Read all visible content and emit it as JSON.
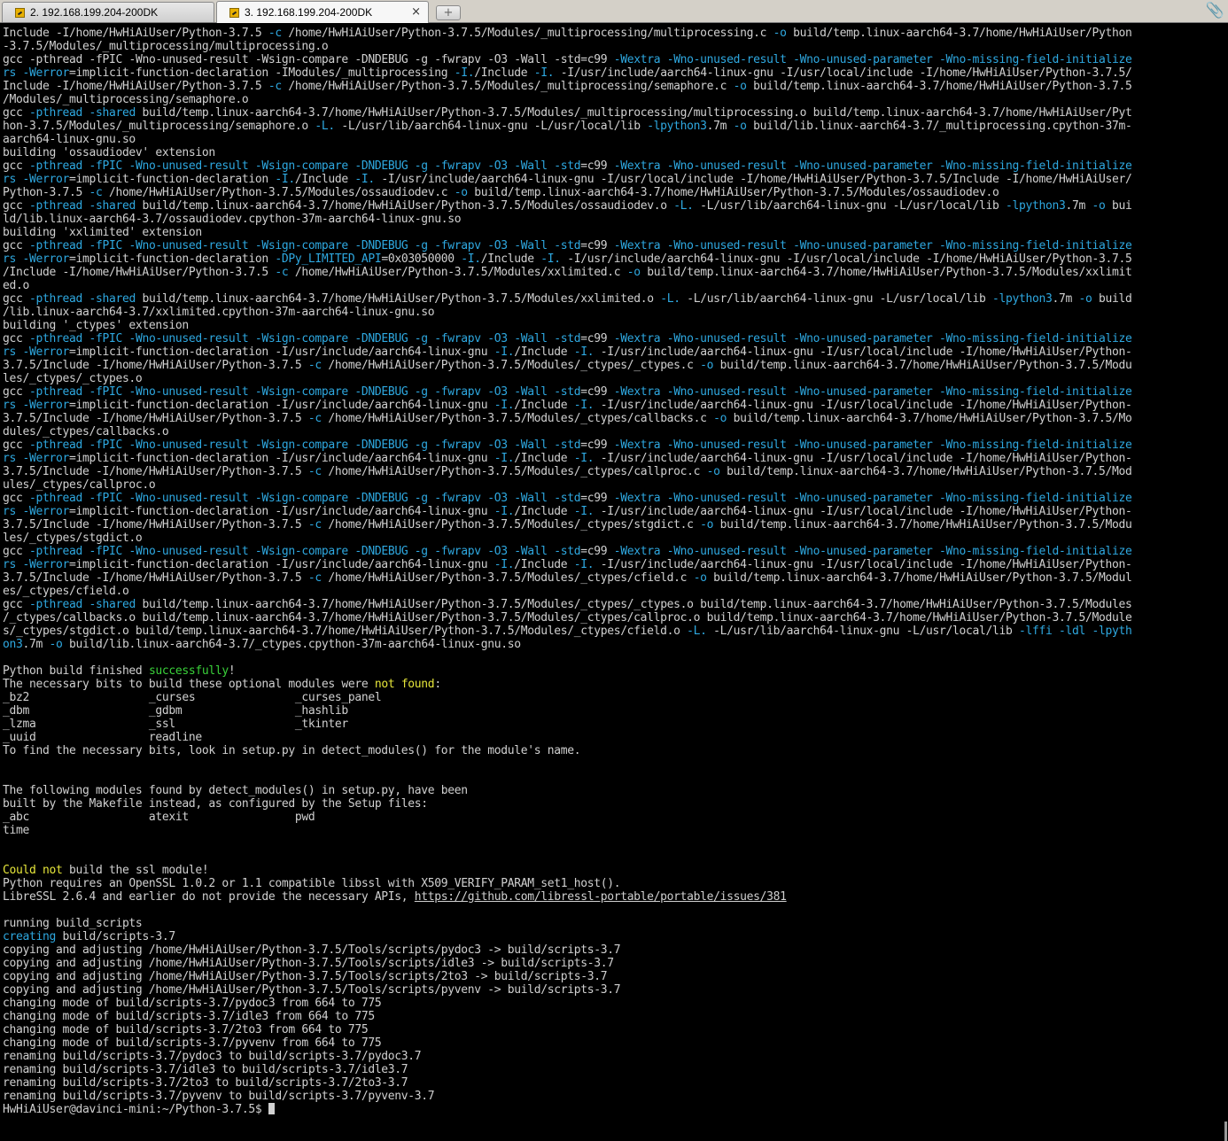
{
  "tabs": [
    {
      "label": "2. 192.168.199.204-200DK",
      "active": false
    },
    {
      "label": "3. 192.168.199.204-200DK",
      "active": true
    }
  ],
  "new_tab_symbol": "+",
  "close_symbol": "×",
  "attach_symbol": "📎",
  "colors": {
    "background": "#000000",
    "text": "#d0d0d0",
    "option": "#2ea8e0",
    "success": "#3ad23a",
    "warning": "#e6e63a"
  },
  "terminal": {
    "lines": [
      [
        [
          "Include -I/home/HwHiAiUser/Python-3.7.5 ",
          ""
        ],
        [
          "-c",
          "c"
        ],
        [
          " /home/HwHiAiUser/Python-3.7.5/Modules/_multiprocessing/multiprocessing.c ",
          ""
        ],
        [
          "-o",
          "c"
        ],
        [
          " build/temp.linux-aarch64-3.7/home/HwHiAiUser/Python",
          ""
        ]
      ],
      [
        [
          "-3.7.5/Modules/_multiprocessing/multiprocessing.o",
          ""
        ]
      ],
      [
        [
          "gcc ",
          ""
        ],
        [
          "-pthread -fPIC -Wno-unused-result -Wsign-compare -DNDEBUG -g -fwrapv -O3 -Wall -std",
          ""
        ],
        [
          "=c99 ",
          ""
        ],
        [
          "-Wextra -Wno-unused-result -Wno-unused-parameter -Wno-missing-field-initialize",
          "c"
        ]
      ],
      [
        [
          "rs -Werror",
          "c"
        ],
        [
          "=implicit-function-declaration -IModules/_multiprocessing ",
          ""
        ],
        [
          "-I.",
          "c"
        ],
        [
          "/Include ",
          ""
        ],
        [
          "-I.",
          "c"
        ],
        [
          " -I/usr/include/aarch64-linux-gnu -I/usr/local/include -I/home/HwHiAiUser/Python-3.7.5/",
          ""
        ]
      ],
      [
        [
          "Include -I/home/HwHiAiUser/Python-3.7.5 ",
          ""
        ],
        [
          "-c",
          "c"
        ],
        [
          " /home/HwHiAiUser/Python-3.7.5/Modules/_multiprocessing/semaphore.c ",
          ""
        ],
        [
          "-o",
          "c"
        ],
        [
          " build/temp.linux-aarch64-3.7/home/HwHiAiUser/Python-3.7.5",
          ""
        ]
      ],
      [
        [
          "/Modules/_multiprocessing/semaphore.o",
          ""
        ]
      ],
      [
        [
          "gcc ",
          ""
        ],
        [
          "-pthread -shared",
          "c"
        ],
        [
          " build/temp.linux-aarch64-3.7/home/HwHiAiUser/Python-3.7.5/Modules/_multiprocessing/multiprocessing.o build/temp.linux-aarch64-3.7/home/HwHiAiUser/Pyt",
          ""
        ]
      ],
      [
        [
          "hon-3.7.5/Modules/_multiprocessing/semaphore.o ",
          ""
        ],
        [
          "-L.",
          "c"
        ],
        [
          " -L/usr/lib/aarch64-linux-gnu -L/usr/local/lib ",
          ""
        ],
        [
          "-lpython3",
          "c"
        ],
        [
          ".7m ",
          ""
        ],
        [
          "-o",
          "c"
        ],
        [
          " build/lib.linux-aarch64-3.7/_multiprocessing.cpython-37m-",
          ""
        ]
      ],
      [
        [
          "aarch64-linux-gnu.so",
          ""
        ]
      ],
      [
        [
          "building 'ossaudiodev' extension",
          ""
        ]
      ],
      [
        [
          "gcc ",
          ""
        ],
        [
          "-pthread -fPIC -Wno-unused-result -Wsign-compare -DNDEBUG -g -fwrapv -O3 -Wall -std",
          "c"
        ],
        [
          "=c99 ",
          ""
        ],
        [
          "-Wextra -Wno-unused-result -Wno-unused-parameter -Wno-missing-field-initialize",
          "c"
        ]
      ],
      [
        [
          "rs -Werror",
          "c"
        ],
        [
          "=implicit-function-declaration ",
          ""
        ],
        [
          "-I.",
          "c"
        ],
        [
          "/Include ",
          ""
        ],
        [
          "-I.",
          "c"
        ],
        [
          " -I/usr/include/aarch64-linux-gnu -I/usr/local/include -I/home/HwHiAiUser/Python-3.7.5/Include -I/home/HwHiAiUser/",
          ""
        ]
      ],
      [
        [
          "Python-3.7.5 ",
          ""
        ],
        [
          "-c",
          "c"
        ],
        [
          " /home/HwHiAiUser/Python-3.7.5/Modules/ossaudiodev.c ",
          ""
        ],
        [
          "-o",
          "c"
        ],
        [
          " build/temp.linux-aarch64-3.7/home/HwHiAiUser/Python-3.7.5/Modules/ossaudiodev.o",
          ""
        ]
      ],
      [
        [
          "gcc ",
          ""
        ],
        [
          "-pthread -shared",
          "c"
        ],
        [
          " build/temp.linux-aarch64-3.7/home/HwHiAiUser/Python-3.7.5/Modules/ossaudiodev.o ",
          ""
        ],
        [
          "-L.",
          "c"
        ],
        [
          " -L/usr/lib/aarch64-linux-gnu -L/usr/local/lib ",
          ""
        ],
        [
          "-lpython3",
          "c"
        ],
        [
          ".7m ",
          ""
        ],
        [
          "-o",
          "c"
        ],
        [
          " bui",
          ""
        ]
      ],
      [
        [
          "ld/lib.linux-aarch64-3.7/ossaudiodev.cpython-37m-aarch64-linux-gnu.so",
          ""
        ]
      ],
      [
        [
          "building 'xxlimited' extension",
          ""
        ]
      ],
      [
        [
          "gcc ",
          ""
        ],
        [
          "-pthread -fPIC -Wno-unused-result -Wsign-compare -DNDEBUG -g -fwrapv -O3 -Wall -std",
          "c"
        ],
        [
          "=c99 ",
          ""
        ],
        [
          "-Wextra -Wno-unused-result -Wno-unused-parameter -Wno-missing-field-initialize",
          "c"
        ]
      ],
      [
        [
          "rs -Werror",
          "c"
        ],
        [
          "=implicit-function-declaration ",
          ""
        ],
        [
          "-DPy_LIMITED_API",
          "c"
        ],
        [
          "=0x03050000 ",
          ""
        ],
        [
          "-I.",
          "c"
        ],
        [
          "/Include ",
          ""
        ],
        [
          "-I.",
          "c"
        ],
        [
          " -I/usr/include/aarch64-linux-gnu -I/usr/local/include -I/home/HwHiAiUser/Python-3.7.5",
          ""
        ]
      ],
      [
        [
          "/Include -I/home/HwHiAiUser/Python-3.7.5 ",
          ""
        ],
        [
          "-c",
          "c"
        ],
        [
          " /home/HwHiAiUser/Python-3.7.5/Modules/xxlimited.c ",
          ""
        ],
        [
          "-o",
          "c"
        ],
        [
          " build/temp.linux-aarch64-3.7/home/HwHiAiUser/Python-3.7.5/Modules/xxlimit",
          ""
        ]
      ],
      [
        [
          "ed.o",
          ""
        ]
      ],
      [
        [
          "gcc ",
          ""
        ],
        [
          "-pthread -shared",
          "c"
        ],
        [
          " build/temp.linux-aarch64-3.7/home/HwHiAiUser/Python-3.7.5/Modules/xxlimited.o ",
          ""
        ],
        [
          "-L.",
          "c"
        ],
        [
          " -L/usr/lib/aarch64-linux-gnu -L/usr/local/lib ",
          ""
        ],
        [
          "-lpython3",
          "c"
        ],
        [
          ".7m ",
          ""
        ],
        [
          "-o",
          "c"
        ],
        [
          " build",
          ""
        ]
      ],
      [
        [
          "/lib.linux-aarch64-3.7/xxlimited.cpython-37m-aarch64-linux-gnu.so",
          ""
        ]
      ],
      [
        [
          "building '_ctypes' extension",
          ""
        ]
      ],
      [
        [
          "gcc ",
          ""
        ],
        [
          "-pthread -fPIC -Wno-unused-result -Wsign-compare -DNDEBUG -g -fwrapv -O3 -Wall -std",
          "c"
        ],
        [
          "=c99 ",
          ""
        ],
        [
          "-Wextra -Wno-unused-result -Wno-unused-parameter -Wno-missing-field-initialize",
          "c"
        ]
      ],
      [
        [
          "rs -Werror",
          "c"
        ],
        [
          "=implicit-function-declaration -I/usr/include/aarch64-linux-gnu ",
          ""
        ],
        [
          "-I.",
          "c"
        ],
        [
          "/Include ",
          ""
        ],
        [
          "-I.",
          "c"
        ],
        [
          " -I/usr/include/aarch64-linux-gnu -I/usr/local/include -I/home/HwHiAiUser/Python-",
          ""
        ]
      ],
      [
        [
          "3.7.5/Include -I/home/HwHiAiUser/Python-3.7.5 ",
          ""
        ],
        [
          "-c",
          "c"
        ],
        [
          " /home/HwHiAiUser/Python-3.7.5/Modules/_ctypes/_ctypes.c ",
          ""
        ],
        [
          "-o",
          "c"
        ],
        [
          " build/temp.linux-aarch64-3.7/home/HwHiAiUser/Python-3.7.5/Modu",
          ""
        ]
      ],
      [
        [
          "les/_ctypes/_ctypes.o",
          ""
        ]
      ],
      [
        [
          "gcc ",
          ""
        ],
        [
          "-pthread -fPIC -Wno-unused-result -Wsign-compare -DNDEBUG -g -fwrapv -O3 -Wall -std",
          "c"
        ],
        [
          "=c99 ",
          ""
        ],
        [
          "-Wextra -Wno-unused-result -Wno-unused-parameter -Wno-missing-field-initialize",
          "c"
        ]
      ],
      [
        [
          "rs -Werror",
          "c"
        ],
        [
          "=implicit-function-declaration -I/usr/include/aarch64-linux-gnu ",
          ""
        ],
        [
          "-I.",
          "c"
        ],
        [
          "/Include ",
          ""
        ],
        [
          "-I.",
          "c"
        ],
        [
          " -I/usr/include/aarch64-linux-gnu -I/usr/local/include -I/home/HwHiAiUser/Python-",
          ""
        ]
      ],
      [
        [
          "3.7.5/Include -I/home/HwHiAiUser/Python-3.7.5 ",
          ""
        ],
        [
          "-c",
          "c"
        ],
        [
          " /home/HwHiAiUser/Python-3.7.5/Modules/_ctypes/callbacks.c ",
          ""
        ],
        [
          "-o",
          "c"
        ],
        [
          " build/temp.linux-aarch64-3.7/home/HwHiAiUser/Python-3.7.5/Mo",
          ""
        ]
      ],
      [
        [
          "dules/_ctypes/callbacks.o",
          ""
        ]
      ],
      [
        [
          "gcc ",
          ""
        ],
        [
          "-pthread -fPIC -Wno-unused-result -Wsign-compare -DNDEBUG -g -fwrapv -O3 -Wall -std",
          "c"
        ],
        [
          "=c99 ",
          ""
        ],
        [
          "-Wextra -Wno-unused-result -Wno-unused-parameter -Wno-missing-field-initialize",
          "c"
        ]
      ],
      [
        [
          "rs -Werror",
          "c"
        ],
        [
          "=implicit-function-declaration -I/usr/include/aarch64-linux-gnu ",
          ""
        ],
        [
          "-I.",
          "c"
        ],
        [
          "/Include ",
          ""
        ],
        [
          "-I.",
          "c"
        ],
        [
          " -I/usr/include/aarch64-linux-gnu -I/usr/local/include -I/home/HwHiAiUser/Python-",
          ""
        ]
      ],
      [
        [
          "3.7.5/Include -I/home/HwHiAiUser/Python-3.7.5 ",
          ""
        ],
        [
          "-c",
          "c"
        ],
        [
          " /home/HwHiAiUser/Python-3.7.5/Modules/_ctypes/callproc.c ",
          ""
        ],
        [
          "-o",
          "c"
        ],
        [
          " build/temp.linux-aarch64-3.7/home/HwHiAiUser/Python-3.7.5/Mod",
          ""
        ]
      ],
      [
        [
          "ules/_ctypes/callproc.o",
          ""
        ]
      ],
      [
        [
          "gcc ",
          ""
        ],
        [
          "-pthread -fPIC -Wno-unused-result -Wsign-compare -DNDEBUG -g -fwrapv -O3 -Wall -std",
          "c"
        ],
        [
          "=c99 ",
          ""
        ],
        [
          "-Wextra -Wno-unused-result -Wno-unused-parameter -Wno-missing-field-initialize",
          "c"
        ]
      ],
      [
        [
          "rs -Werror",
          "c"
        ],
        [
          "=implicit-function-declaration -I/usr/include/aarch64-linux-gnu ",
          ""
        ],
        [
          "-I.",
          "c"
        ],
        [
          "/Include ",
          ""
        ],
        [
          "-I.",
          "c"
        ],
        [
          " -I/usr/include/aarch64-linux-gnu -I/usr/local/include -I/home/HwHiAiUser/Python-",
          ""
        ]
      ],
      [
        [
          "3.7.5/Include -I/home/HwHiAiUser/Python-3.7.5 ",
          ""
        ],
        [
          "-c",
          "c"
        ],
        [
          " /home/HwHiAiUser/Python-3.7.5/Modules/_ctypes/stgdict.c ",
          ""
        ],
        [
          "-o",
          "c"
        ],
        [
          " build/temp.linux-aarch64-3.7/home/HwHiAiUser/Python-3.7.5/Modu",
          ""
        ]
      ],
      [
        [
          "les/_ctypes/stgdict.o",
          ""
        ]
      ],
      [
        [
          "gcc ",
          ""
        ],
        [
          "-pthread -fPIC -Wno-unused-result -Wsign-compare -DNDEBUG -g -fwrapv -O3 -Wall -std",
          "c"
        ],
        [
          "=c99 ",
          ""
        ],
        [
          "-Wextra -Wno-unused-result -Wno-unused-parameter -Wno-missing-field-initialize",
          "c"
        ]
      ],
      [
        [
          "rs -Werror",
          "c"
        ],
        [
          "=implicit-function-declaration -I/usr/include/aarch64-linux-gnu ",
          ""
        ],
        [
          "-I.",
          "c"
        ],
        [
          "/Include ",
          ""
        ],
        [
          "-I.",
          "c"
        ],
        [
          " -I/usr/include/aarch64-linux-gnu -I/usr/local/include -I/home/HwHiAiUser/Python-",
          ""
        ]
      ],
      [
        [
          "3.7.5/Include -I/home/HwHiAiUser/Python-3.7.5 ",
          ""
        ],
        [
          "-c",
          "c"
        ],
        [
          " /home/HwHiAiUser/Python-3.7.5/Modules/_ctypes/cfield.c ",
          ""
        ],
        [
          "-o",
          "c"
        ],
        [
          " build/temp.linux-aarch64-3.7/home/HwHiAiUser/Python-3.7.5/Modul",
          ""
        ]
      ],
      [
        [
          "es/_ctypes/cfield.o",
          ""
        ]
      ],
      [
        [
          "gcc ",
          ""
        ],
        [
          "-pthread -shared",
          "c"
        ],
        [
          " build/temp.linux-aarch64-3.7/home/HwHiAiUser/Python-3.7.5/Modules/_ctypes/_ctypes.o build/temp.linux-aarch64-3.7/home/HwHiAiUser/Python-3.7.5/Modules",
          ""
        ]
      ],
      [
        [
          "/_ctypes/callbacks.o build/temp.linux-aarch64-3.7/home/HwHiAiUser/Python-3.7.5/Modules/_ctypes/callproc.o build/temp.linux-aarch64-3.7/home/HwHiAiUser/Python-3.7.5/Module",
          ""
        ]
      ],
      [
        [
          "s/_ctypes/stgdict.o build/temp.linux-aarch64-3.7/home/HwHiAiUser/Python-3.7.5/Modules/_ctypes/cfield.o ",
          ""
        ],
        [
          "-L.",
          "c"
        ],
        [
          " -L/usr/lib/aarch64-linux-gnu -L/usr/local/lib ",
          ""
        ],
        [
          "-lffi -ldl -lpyth",
          "c"
        ]
      ],
      [
        [
          "on3",
          "c"
        ],
        [
          ".7m ",
          ""
        ],
        [
          "-o",
          "c"
        ],
        [
          " build/lib.linux-aarch64-3.7/_ctypes.cpython-37m-aarch64-linux-gnu.so",
          ""
        ]
      ],
      [],
      [
        [
          "Python build finished ",
          ""
        ],
        [
          "successfully",
          "g"
        ],
        [
          "!",
          ""
        ]
      ],
      [
        [
          "The necessary bits to build these optional modules were ",
          ""
        ],
        [
          "not found",
          "y"
        ],
        [
          ":",
          ""
        ]
      ],
      [
        [
          "_bz2                  _curses               _curses_panel",
          ""
        ]
      ],
      [
        [
          "_dbm                  _gdbm                 _hashlib",
          ""
        ]
      ],
      [
        [
          "_lzma                 _ssl                  _tkinter",
          ""
        ]
      ],
      [
        [
          "_uuid                 readline",
          ""
        ]
      ],
      [
        [
          "To find the necessary bits, look in setup.py in detect_modules() for the module's name.",
          ""
        ]
      ],
      [],
      [],
      [
        [
          "The following modules found by detect_modules() in setup.py, have been",
          ""
        ]
      ],
      [
        [
          "built by the Makefile instead, as configured by the Setup files:",
          ""
        ]
      ],
      [
        [
          "_abc                  atexit                pwd",
          ""
        ]
      ],
      [
        [
          "time",
          ""
        ]
      ],
      [],
      [],
      [
        [
          "Could not",
          "y"
        ],
        [
          " build the ssl module!",
          ""
        ]
      ],
      [
        [
          "Python requires an OpenSSL 1.0.2 or 1.1 compatible libssl with X509_VERIFY_PARAM_set1_host().",
          ""
        ]
      ],
      [
        [
          "LibreSSL 2.6.4 and earlier do not provide the necessary APIs, ",
          ""
        ],
        [
          "https://github.com/libressl-portable/portable/issues/381",
          "u"
        ]
      ],
      [],
      [
        [
          "running build_scripts",
          ""
        ]
      ],
      [
        [
          "creating",
          "c"
        ],
        [
          " build/scripts-3.7",
          ""
        ]
      ],
      [
        [
          "copying and adjusting /home/HwHiAiUser/Python-3.7.5/Tools/scripts/pydoc3 -> build/scripts-3.7",
          ""
        ]
      ],
      [
        [
          "copying and adjusting /home/HwHiAiUser/Python-3.7.5/Tools/scripts/idle3 -> build/scripts-3.7",
          ""
        ]
      ],
      [
        [
          "copying and adjusting /home/HwHiAiUser/Python-3.7.5/Tools/scripts/2to3 -> build/scripts-3.7",
          ""
        ]
      ],
      [
        [
          "copying and adjusting /home/HwHiAiUser/Python-3.7.5/Tools/scripts/pyvenv -> build/scripts-3.7",
          ""
        ]
      ],
      [
        [
          "changing mode of build/scripts-3.7/pydoc3 from 664 to 775",
          ""
        ]
      ],
      [
        [
          "changing mode of build/scripts-3.7/idle3 from 664 to 775",
          ""
        ]
      ],
      [
        [
          "changing mode of build/scripts-3.7/2to3 from 664 to 775",
          ""
        ]
      ],
      [
        [
          "changing mode of build/scripts-3.7/pyvenv from 664 to 775",
          ""
        ]
      ],
      [
        [
          "renaming build/scripts-3.7/pydoc3 to build/scripts-3.7/pydoc3.7",
          ""
        ]
      ],
      [
        [
          "renaming build/scripts-3.7/idle3 to build/scripts-3.7/idle3.7",
          ""
        ]
      ],
      [
        [
          "renaming build/scripts-3.7/2to3 to build/scripts-3.7/2to3-3.7",
          ""
        ]
      ],
      [
        [
          "renaming build/scripts-3.7/pyvenv to build/scripts-3.7/pyvenv-3.7",
          ""
        ]
      ]
    ],
    "prompt": "HwHiAiUser@davinci-mini:~/Python-3.7.5$ "
  }
}
